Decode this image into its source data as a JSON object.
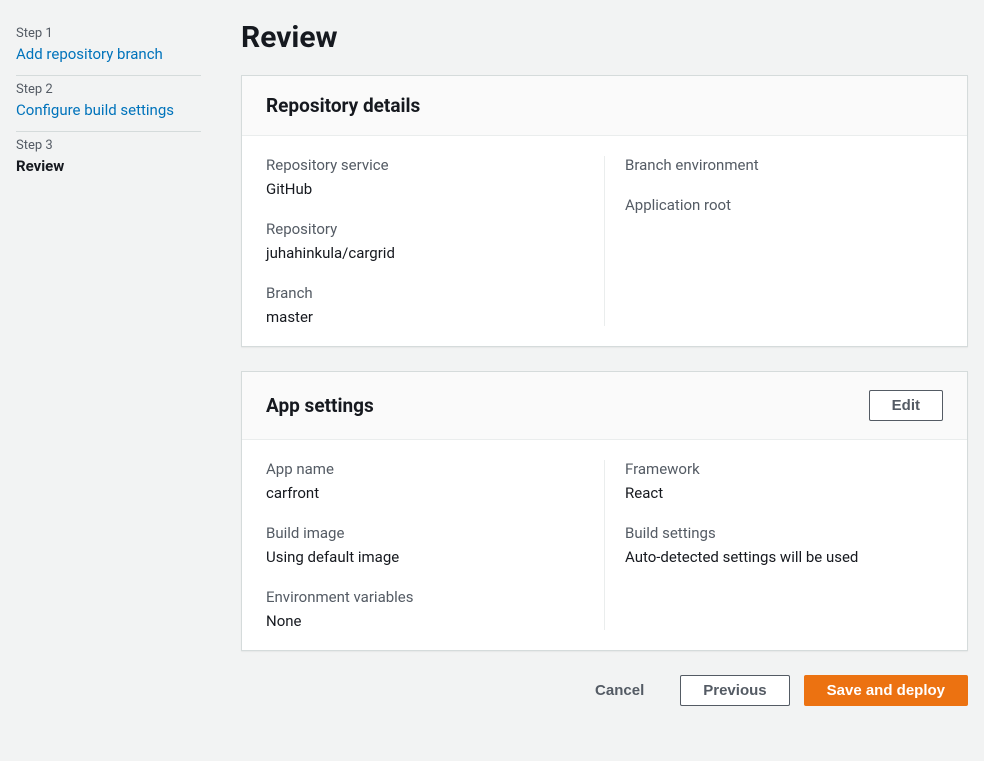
{
  "sidebar": {
    "steps": [
      {
        "label": "Step 1",
        "title": "Add repository branch"
      },
      {
        "label": "Step 2",
        "title": "Configure build settings"
      },
      {
        "label": "Step 3",
        "title": "Review"
      }
    ]
  },
  "page": {
    "title": "Review"
  },
  "repository_card": {
    "title": "Repository details",
    "fields": {
      "repository_service": {
        "label": "Repository service",
        "value": "GitHub"
      },
      "repository": {
        "label": "Repository",
        "value": "juhahinkula/cargrid"
      },
      "branch": {
        "label": "Branch",
        "value": "master"
      },
      "branch_environment": {
        "label": "Branch environment",
        "value": ""
      },
      "application_root": {
        "label": "Application root",
        "value": ""
      }
    }
  },
  "app_settings_card": {
    "title": "App settings",
    "edit_label": "Edit",
    "fields": {
      "app_name": {
        "label": "App name",
        "value": "carfront"
      },
      "build_image": {
        "label": "Build image",
        "value": "Using default image"
      },
      "environment_variables": {
        "label": "Environment variables",
        "value": "None"
      },
      "framework": {
        "label": "Framework",
        "value": "React"
      },
      "build_settings": {
        "label": "Build settings",
        "value": "Auto-detected settings will be used"
      }
    }
  },
  "footer": {
    "cancel": "Cancel",
    "previous": "Previous",
    "save_and_deploy": "Save and deploy"
  }
}
